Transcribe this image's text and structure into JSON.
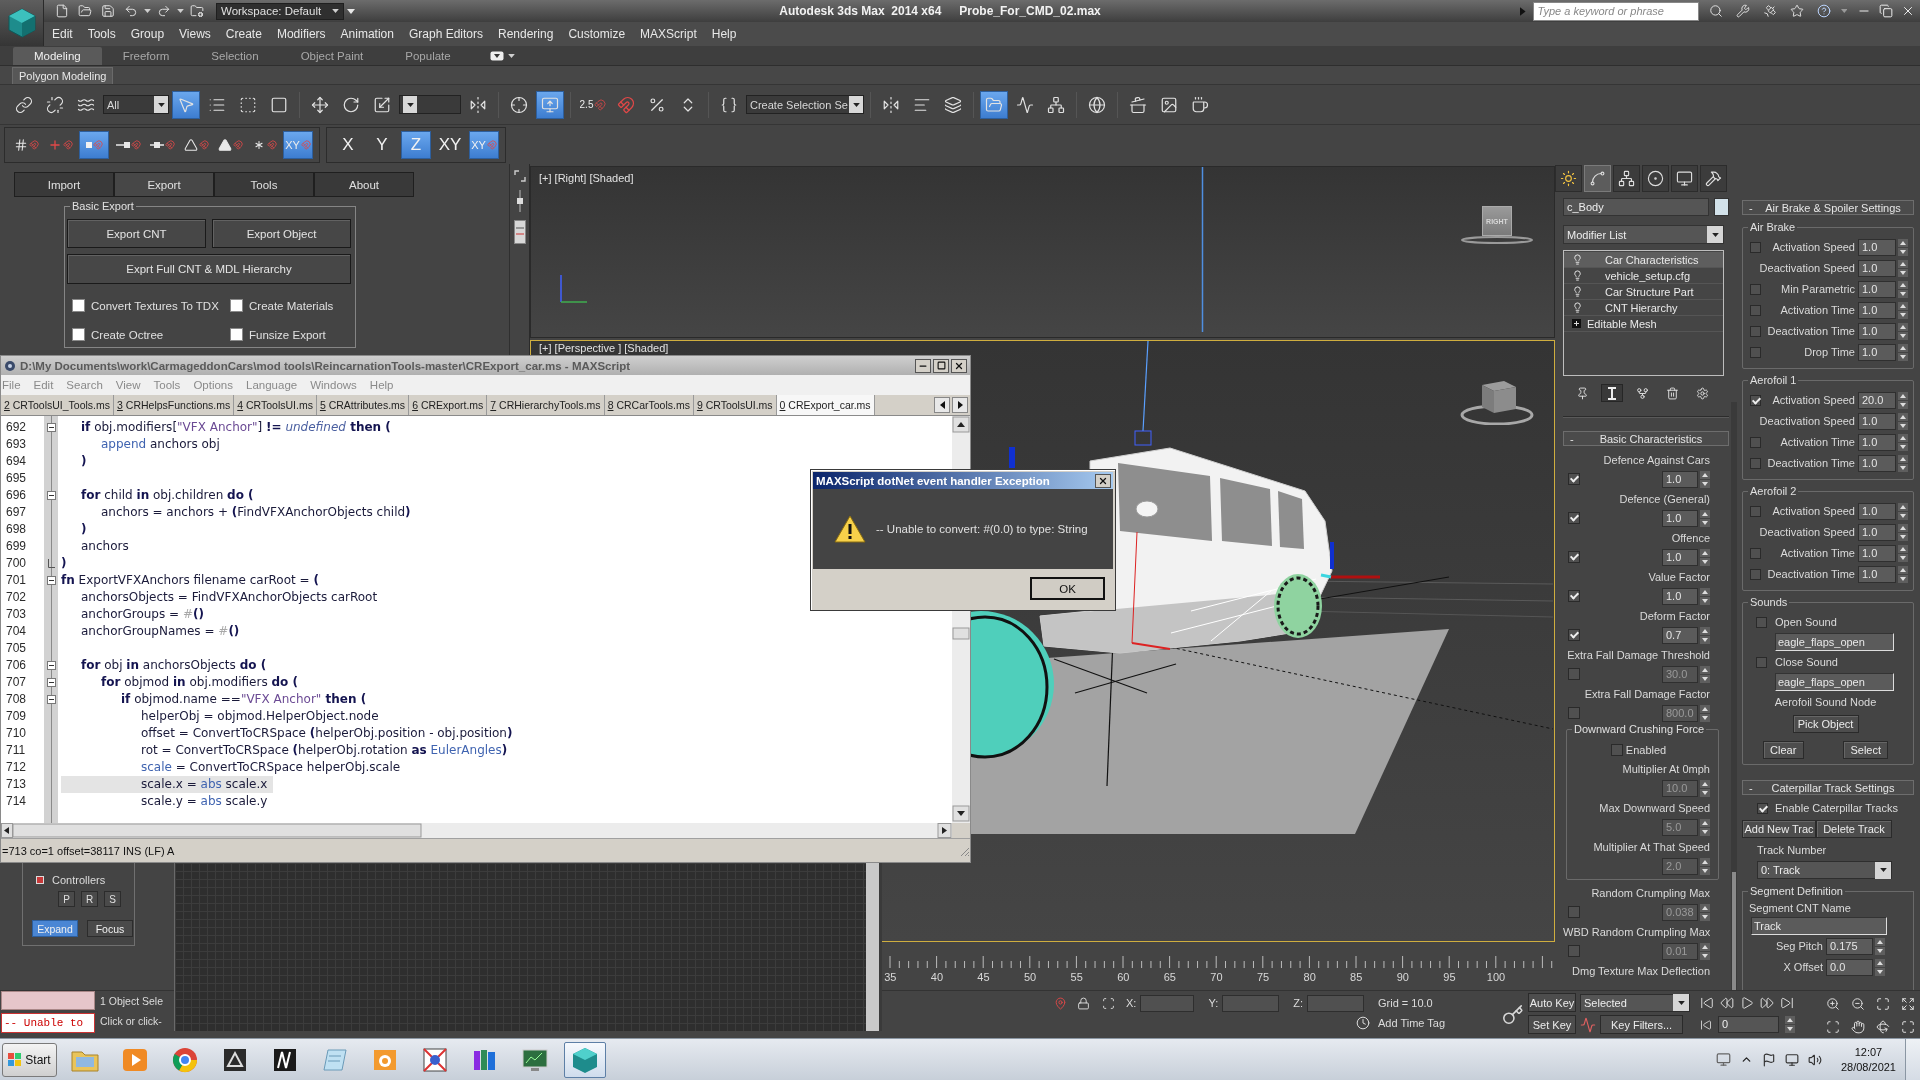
{
  "app": {
    "title": "Autodesk 3ds Max  2014 x64",
    "file": "Probe_For_CMD_02.max",
    "workspace": "Workspace: Default",
    "search_placeholder": "Type a keyword or phrase"
  },
  "menu": [
    "Edit",
    "Tools",
    "Group",
    "Views",
    "Create",
    "Modifiers",
    "Animation",
    "Graph Editors",
    "Rendering",
    "Customize",
    "MAXScript",
    "Help"
  ],
  "ribbon": {
    "tabs": [
      {
        "label": "Modeling",
        "selected": true
      },
      {
        "label": "Freeform",
        "selected": false
      },
      {
        "label": "Selection",
        "selected": false
      },
      {
        "label": "Object Paint",
        "selected": false
      },
      {
        "label": "Populate",
        "selected": false
      }
    ],
    "panel": "Polygon Modeling"
  },
  "main_toolbar": [
    {
      "kind": "link",
      "selected": false
    },
    {
      "kind": "unlink",
      "selected": false
    },
    {
      "kind": "bind",
      "selected": false
    },
    {
      "kind": "filter",
      "value": "All"
    },
    {
      "kind": "select",
      "selected": true
    },
    {
      "kind": "select_by_name",
      "selected": false
    },
    {
      "kind": "region",
      "selected": false
    },
    {
      "kind": "crossing",
      "selected": false
    },
    {
      "kind": "separator"
    },
    {
      "kind": "move",
      "selected": false
    },
    {
      "kind": "rotate",
      "selected": false
    },
    {
      "kind": "scale",
      "selected": false
    },
    {
      "kind": "coordinates"
    },
    {
      "kind": "pivot",
      "selected": false
    },
    {
      "kind": "separator"
    },
    {
      "kind": "manipulate",
      "selected": false
    },
    {
      "kind": "shortcuts",
      "selected": true
    },
    {
      "kind": "separator"
    },
    {
      "kind": "snap",
      "label": "2.5",
      "selected": false
    },
    {
      "kind": "angle_snap",
      "selected": false
    },
    {
      "kind": "percent_snap",
      "selected": false
    },
    {
      "kind": "spinner_snap",
      "selected": false
    },
    {
      "kind": "separator"
    },
    {
      "kind": "named_sets",
      "selected": false
    },
    {
      "kind": "selection_sets",
      "value": "Create Selection Se"
    },
    {
      "kind": "separator"
    },
    {
      "kind": "mirror",
      "selected": false
    },
    {
      "kind": "align",
      "selected": false
    },
    {
      "kind": "layers",
      "selected": false
    },
    {
      "kind": "separator"
    },
    {
      "kind": "explorer",
      "selected": true
    },
    {
      "kind": "curves",
      "selected": false
    },
    {
      "kind": "schematic",
      "selected": false
    },
    {
      "kind": "separator"
    },
    {
      "kind": "material",
      "selected": false
    },
    {
      "kind": "separator"
    },
    {
      "kind": "render_setup",
      "selected": false
    },
    {
      "kind": "frame_window",
      "selected": false
    },
    {
      "kind": "render",
      "selected": false
    }
  ],
  "snap_toolbar": {
    "snaps": [
      {
        "kind": "grid",
        "selected": false
      },
      {
        "kind": "pivot",
        "selected": false
      },
      {
        "kind": "vertex",
        "selected": true
      },
      {
        "kind": "endpoint",
        "selected": false
      },
      {
        "kind": "midpoint",
        "selected": false
      },
      {
        "kind": "edge",
        "selected": false
      },
      {
        "kind": "face",
        "selected": false
      },
      {
        "kind": "center",
        "selected": false
      },
      {
        "kind": "plane",
        "label": "XY",
        "selected": true
      }
    ],
    "axes": [
      {
        "kind": "axis",
        "label": "X",
        "selected": false
      },
      {
        "kind": "axis",
        "label": "Y",
        "selected": false
      },
      {
        "kind": "axis",
        "label": "Z",
        "selected": true
      },
      {
        "kind": "axis",
        "label": "XY",
        "selected": false
      },
      {
        "kind": "axis_snap",
        "label": "XY",
        "selected": true
      }
    ]
  },
  "tool_panel": {
    "tabs": [
      {
        "label": "Import",
        "selected": false
      },
      {
        "label": "Export",
        "selected": true
      },
      {
        "label": "Tools",
        "selected": false
      },
      {
        "label": "About",
        "selected": false
      }
    ],
    "group": "Basic Export",
    "buttons": [
      "Export CNT",
      "Export Object",
      "Exprt Full CNT & MDL Hierarchy"
    ],
    "options": [
      {
        "label": "Convert Textures To TDX",
        "checked": false
      },
      {
        "label": "Create Materials",
        "checked": false
      },
      {
        "label": "Create Octree",
        "checked": false
      },
      {
        "label": "Funsize Export",
        "checked": false
      }
    ]
  },
  "controllers": {
    "title": "Controllers",
    "buttons": [
      "P",
      "R",
      "S"
    ],
    "modes": [
      {
        "label": "Expand",
        "selected": true
      },
      {
        "label": "Focus",
        "selected": false
      }
    ]
  },
  "viewports": [
    {
      "kind": "side",
      "label": "[+] [Right] [Shaded]",
      "active": false,
      "cube_label": "RIGHT"
    },
    {
      "kind": "perspective",
      "label": "[+] [Perspective ] [Shaded]",
      "active": true
    }
  ],
  "timeline": {
    "ticks": [
      "35",
      "40",
      "45",
      "50",
      "55",
      "60",
      "65",
      "70",
      "75",
      "80",
      "85",
      "90",
      "95",
      "100"
    ]
  },
  "script_editor": {
    "title": "D:\\My Documents\\work\\CarmageddonCars\\mod tools\\ReincarnationTools-master\\CRExport_car.ms - MAXScript",
    "menu": [
      "File",
      "Edit",
      "Search",
      "View",
      "Tools",
      "Options",
      "Language",
      "Windows",
      "Help"
    ],
    "tabs": [
      {
        "key": "2",
        "name": "CRToolsUI_Tools.ms",
        "selected": false
      },
      {
        "key": "3",
        "name": "CRHelpsFunctions.ms",
        "selected": false
      },
      {
        "key": "4",
        "name": "CRToolsUI.ms",
        "selected": false
      },
      {
        "key": "5",
        "name": "CRAttributes.ms",
        "selected": false
      },
      {
        "key": "6",
        "name": "CRExport.ms",
        "selected": false
      },
      {
        "key": "7",
        "name": "CRHierarchyTools.ms",
        "selected": false
      },
      {
        "key": "8",
        "name": "CRCarTools.ms",
        "selected": false
      },
      {
        "key": "9",
        "name": "CRToolsUI.ms",
        "selected": false
      },
      {
        "key": "0",
        "name": "CRExport_car.ms",
        "selected": true
      }
    ],
    "lines": [
      {
        "number": "692",
        "kind": "block_start",
        "current": false,
        "tokens": [
          {
            "kind": "keyword",
            "text": "\tif"
          },
          {
            "kind": "plain",
            "text": " obj.modifiers["
          },
          {
            "kind": "string",
            "text": "\"VFX Anchor\""
          },
          {
            "kind": "plain",
            "text": "] "
          },
          {
            "kind": "keyword",
            "text": "!="
          },
          {
            "kind": "constant",
            "text": " undefined"
          },
          {
            "kind": "keyword",
            "text": " then ("
          }
        ]
      },
      {
        "number": "693",
        "kind": "code",
        "current": false,
        "tokens": [
          {
            "kind": "builtin",
            "text": "\t\tappend"
          },
          {
            "kind": "plain",
            "text": " anchors obj"
          }
        ]
      },
      {
        "number": "694",
        "kind": "code",
        "current": false,
        "tokens": [
          {
            "kind": "keyword",
            "text": "\t)"
          }
        ]
      },
      {
        "number": "695",
        "kind": "code",
        "current": false
      },
      {
        "number": "696",
        "kind": "block_start",
        "current": false,
        "tokens": [
          {
            "kind": "keyword",
            "text": "\tfor"
          },
          {
            "kind": "plain",
            "text": " child "
          },
          {
            "kind": "keyword",
            "text": "in"
          },
          {
            "kind": "plain",
            "text": " obj.children "
          },
          {
            "kind": "keyword",
            "text": "do ("
          }
        ]
      },
      {
        "number": "697",
        "kind": "code",
        "current": false,
        "tokens": [
          {
            "kind": "plain",
            "text": "\t\tanchors = anchors + "
          },
          {
            "kind": "keyword",
            "text": "("
          },
          {
            "kind": "plain",
            "text": "FindVFXAnchorObjects child"
          },
          {
            "kind": "keyword",
            "text": ")"
          }
        ]
      },
      {
        "number": "698",
        "kind": "code",
        "current": false,
        "tokens": [
          {
            "kind": "keyword",
            "text": "\t)"
          }
        ]
      },
      {
        "number": "699",
        "kind": "code",
        "current": false,
        "tokens": [
          {
            "kind": "plain",
            "text": "\tanchors"
          }
        ]
      },
      {
        "number": "700",
        "kind": "block_end",
        "current": false,
        "tokens": [
          {
            "kind": "keyword",
            "text": ")"
          }
        ]
      },
      {
        "number": "701",
        "kind": "block_start",
        "current": false,
        "tokens": [
          {
            "kind": "keyword",
            "text": "fn"
          },
          {
            "kind": "plain",
            "text": " ExportVFXAnchors filename carRoot = "
          },
          {
            "kind": "keyword",
            "text": "("
          }
        ]
      },
      {
        "number": "702",
        "kind": "code",
        "current": false,
        "tokens": [
          {
            "kind": "plain",
            "text": "\tanchorsObjects = FindVFXAnchorObjects carRoot"
          }
        ]
      },
      {
        "number": "703",
        "kind": "code",
        "current": false,
        "tokens": [
          {
            "kind": "plain",
            "text": "\tanchorGroups = "
          },
          {
            "kind": "symbol",
            "text": "#"
          },
          {
            "kind": "keyword",
            "text": "()"
          }
        ]
      },
      {
        "number": "704",
        "kind": "code",
        "current": false,
        "tokens": [
          {
            "kind": "plain",
            "text": "\tanchorGroupNames = "
          },
          {
            "kind": "symbol",
            "text": "#"
          },
          {
            "kind": "keyword",
            "text": "()"
          }
        ]
      },
      {
        "number": "705",
        "kind": "code",
        "current": false
      },
      {
        "number": "706",
        "kind": "block_start",
        "current": false,
        "tokens": [
          {
            "kind": "keyword",
            "text": "\tfor"
          },
          {
            "kind": "plain",
            "text": " obj "
          },
          {
            "kind": "keyword",
            "text": "in"
          },
          {
            "kind": "plain",
            "text": " anchorsObjects "
          },
          {
            "kind": "keyword",
            "text": "do ("
          }
        ]
      },
      {
        "number": "707",
        "kind": "block_start",
        "current": false,
        "tokens": [
          {
            "kind": "keyword",
            "text": "\t\tfor"
          },
          {
            "kind": "plain",
            "text": " objmod "
          },
          {
            "kind": "keyword",
            "text": "in"
          },
          {
            "kind": "plain",
            "text": " obj.modifiers "
          },
          {
            "kind": "keyword",
            "text": "do ("
          }
        ]
      },
      {
        "number": "708",
        "kind": "block_start",
        "current": false,
        "tokens": [
          {
            "kind": "keyword",
            "text": "\t\t\tif"
          },
          {
            "kind": "plain",
            "text": " objmod.name =="
          },
          {
            "kind": "string",
            "text": "\"VFX Anchor\""
          },
          {
            "kind": "keyword",
            "text": " then ("
          }
        ]
      },
      {
        "number": "709",
        "kind": "code",
        "current": false,
        "tokens": [
          {
            "kind": "plain",
            "text": "\t\t\t\thelperObj = objmod.HelperObject.node"
          }
        ]
      },
      {
        "number": "710",
        "kind": "code",
        "current": false,
        "tokens": [
          {
            "kind": "plain",
            "text": "\t\t\t\toffset = ConvertToCRSpace "
          },
          {
            "kind": "keyword",
            "text": "("
          },
          {
            "kind": "plain",
            "text": "helperObj.position - obj.position"
          },
          {
            "kind": "keyword",
            "text": ")"
          }
        ]
      },
      {
        "number": "711",
        "kind": "code",
        "current": false,
        "tokens": [
          {
            "kind": "plain",
            "text": "\t\t\t\trot = ConvertToCRSpace "
          },
          {
            "kind": "keyword",
            "text": "("
          },
          {
            "kind": "plain",
            "text": "helperObj.rotation "
          },
          {
            "kind": "keyword",
            "text": "as"
          },
          {
            "kind": "builtin",
            "text": " EulerAngles"
          },
          {
            "kind": "keyword",
            "text": ")"
          }
        ]
      },
      {
        "number": "712",
        "kind": "code",
        "current": false,
        "tokens": [
          {
            "kind": "builtin",
            "text": "\t\t\t\tscale"
          },
          {
            "kind": "plain",
            "text": " = ConvertToCRSpace helperObj.scale"
          }
        ]
      },
      {
        "number": "713",
        "kind": "code",
        "current": true,
        "tokens": [
          {
            "kind": "plain",
            "text": "\t\t\t\tscale.x = "
          },
          {
            "kind": "builtin",
            "text": "abs"
          },
          {
            "kind": "plain",
            "text": " scale.x"
          }
        ]
      },
      {
        "number": "714",
        "kind": "code",
        "current": false,
        "tokens": [
          {
            "kind": "plain",
            "text": "\t\t\t\tscale.y = "
          },
          {
            "kind": "builtin",
            "text": "abs"
          },
          {
            "kind": "plain",
            "text": " scale.y"
          }
        ]
      }
    ],
    "status": "=713 co=1 offset=38117 INS (LF) A"
  },
  "dialog": {
    "title": "MAXScript dotNet event handler Exception",
    "message": "-- Unable to convert: #(0.0) to type: String",
    "button": "OK"
  },
  "command_panel": {
    "tabs": [
      {
        "kind": "create",
        "selected": false
      },
      {
        "kind": "modify",
        "selected": true
      },
      {
        "kind": "hierarchy",
        "selected": false
      },
      {
        "kind": "motion",
        "selected": false
      },
      {
        "kind": "display",
        "selected": false
      },
      {
        "kind": "utilities",
        "selected": false
      }
    ],
    "object": {
      "name": "c_Body",
      "color": "#d3e2ea"
    },
    "modifier_list": "Modifier List",
    "stack": [
      {
        "kind": "modifier",
        "label": "Car Characteristics",
        "selected": true
      },
      {
        "kind": "modifier",
        "label": "vehicle_setup.cfg",
        "selected": false
      },
      {
        "kind": "modifier",
        "label": "Car Structure Part",
        "selected": false
      },
      {
        "kind": "modifier",
        "label": "CNT Hierarchy",
        "selected": false
      },
      {
        "kind": "object",
        "label": "Editable Mesh",
        "selected": false
      }
    ],
    "stack_tools": [
      {
        "kind": "pin",
        "selected": false
      },
      {
        "kind": "end_result",
        "selected": true
      },
      {
        "kind": "unique",
        "selected": false
      },
      {
        "kind": "remove",
        "selected": false
      },
      {
        "kind": "configure",
        "selected": false
      }
    ],
    "basic": {
      "toggle": "-",
      "title": "Basic Characteristics",
      "params": [
        {
          "kind": "check_spinner",
          "label": "Defence Against Cars",
          "checked": true,
          "value": "1.0",
          "disabled": false
        },
        {
          "kind": "check_spinner",
          "label": "Defence (General)",
          "checked": true,
          "value": "1.0",
          "disabled": false
        },
        {
          "kind": "check_spinner",
          "label": "Offence",
          "checked": true,
          "value": "1.0",
          "disabled": false
        },
        {
          "kind": "check_spinner",
          "label": "Value Factor",
          "checked": true,
          "value": "1.0",
          "disabled": false
        },
        {
          "kind": "check_spinner",
          "label": "Deform Factor",
          "checked": true,
          "value": "0.7",
          "disabled": false
        },
        {
          "kind": "check_spinner",
          "label": "Extra Fall Damage Threshold",
          "checked": false,
          "value": "30.0",
          "disabled": true
        },
        {
          "kind": "check_spinner",
          "label": "Extra Fall Damage Factor",
          "checked": false,
          "value": "800.0",
          "disabled": true
        },
        {
          "kind": "group",
          "title": "Downward Crushing Force",
          "items": [
            {
              "kind": "checkbox",
              "label": "Enabled",
              "checked": false
            },
            {
              "kind": "spinner",
              "label": "Multiplier At 0mph",
              "value": "10.0",
              "disabled": true
            },
            {
              "kind": "spinner",
              "label": "Max Downward Speed",
              "value": "5.0",
              "disabled": true
            },
            {
              "kind": "spinner",
              "label": "Multiplier At That Speed",
              "value": "2.0",
              "disabled": true
            }
          ]
        },
        {
          "kind": "check_spinner",
          "label": "Random Crumpling Max",
          "checked": false,
          "value": "0.038",
          "disabled": true
        },
        {
          "kind": "check_spinner",
          "label": "WBD Random Crumpling Max",
          "checked": false,
          "value": "0.01",
          "disabled": true
        },
        {
          "kind": "caption",
          "label": "Dmg Texture Max Deflection"
        }
      ]
    },
    "air_brake": {
      "toggle": "-",
      "title": "Air Brake & Spoiler Settings",
      "groups": [
        {
          "title": "Air Brake",
          "rows": [
            {
              "kind": "check_spinner",
              "label": "Activation Speed",
              "checked": false,
              "value": "1.0"
            },
            {
              "kind": "spinner",
              "label": "Deactivation Speed",
              "value": "1.0"
            },
            {
              "kind": "check_spinner",
              "label": "Min Parametric",
              "checked": false,
              "value": "1.0"
            },
            {
              "kind": "check_spinner",
              "label": "Activation Time",
              "checked": false,
              "value": "1.0"
            },
            {
              "kind": "check_spinner",
              "label": "Deactivation Time",
              "checked": false,
              "value": "1.0"
            },
            {
              "kind": "check_spinner",
              "label": "Drop Time",
              "checked": false,
              "value": "1.0"
            }
          ]
        },
        {
          "title": "Aerofoil 1",
          "rows": [
            {
              "kind": "check_spinner",
              "label": "Activation Speed",
              "checked": true,
              "value": "20.0"
            },
            {
              "kind": "spinner",
              "label": "Deactivation Speed",
              "value": "1.0"
            },
            {
              "kind": "check_spinner",
              "label": "Activation Time",
              "checked": false,
              "value": "1.0"
            },
            {
              "kind": "check_spinner",
              "label": "Deactivation Time",
              "checked": false,
              "value": "1.0"
            }
          ]
        },
        {
          "title": "Aerofoil 2",
          "rows": [
            {
              "kind": "check_spinner",
              "label": "Activation Speed",
              "checked": false,
              "value": "1.0"
            },
            {
              "kind": "spinner",
              "label": "Deactivation Speed",
              "value": "1.0"
            },
            {
              "kind": "check_spinner",
              "label": "Activation Time",
              "checked": false,
              "value": "1.0"
            },
            {
              "kind": "check_spinner",
              "label": "Deactivation Time",
              "checked": false,
              "value": "1.0"
            }
          ]
        }
      ],
      "sounds": {
        "title": "Sounds",
        "items": [
          {
            "kind": "checkbox",
            "label": "Open Sound",
            "checked": false
          },
          {
            "kind": "field",
            "value": "eagle_flaps_open"
          },
          {
            "kind": "checkbox",
            "label": "Close Sound",
            "checked": false
          },
          {
            "kind": "field",
            "value": "eagle_flaps_open"
          },
          {
            "kind": "caption",
            "label": "Aerofoil Sound Node"
          },
          {
            "kind": "button",
            "label": "Pick Object"
          },
          {
            "kind": "buttons",
            "labels": [
              "Clear",
              "Select"
            ]
          }
        ]
      }
    },
    "caterpillar": {
      "toggle": "-",
      "title": "Caterpillar Track Settings",
      "enable": {
        "label": "Enable Caterpillar Tracks",
        "checked": true
      },
      "buttons": [
        "Add New Trac",
        "Delete Track"
      ],
      "track_label": "Track Number",
      "track": "0: Track",
      "segment": {
        "title": "Segment Definition",
        "name_label": "Segment CNT Name",
        "name": "Track",
        "rows": [
          {
            "label": "Seg Pitch",
            "value": "0.175"
          },
          {
            "label": "X Offset",
            "value": "0.0"
          }
        ]
      }
    }
  },
  "status_bar": {
    "listener_output": "-- Unable to",
    "selection": "1 Object Sele",
    "prompt": "Click or click-",
    "coords": [
      "X:",
      "Y:",
      "Z:"
    ],
    "grid": "Grid = 10.0",
    "time_tag": "Add Time Tag",
    "auto_key": "Auto Key",
    "key_mode": "Selected",
    "set_key": "Set Key",
    "key_filters": "Key Filters...",
    "frame": "0"
  },
  "taskbar": {
    "start": "Start",
    "apps": [
      {
        "kind": "folder",
        "selected": false
      },
      {
        "kind": "player",
        "selected": false
      },
      {
        "kind": "browser",
        "selected": false
      },
      {
        "kind": "tile",
        "selected": false
      },
      {
        "kind": "clapper",
        "selected": false
      },
      {
        "kind": "notepad",
        "selected": false
      },
      {
        "kind": "camera",
        "selected": false
      },
      {
        "kind": "shapes",
        "selected": false
      },
      {
        "kind": "books",
        "selected": false
      },
      {
        "kind": "chart",
        "selected": false
      },
      {
        "kind": "max",
        "selected": true
      }
    ],
    "time": "12:07",
    "date": "28/08/2021"
  }
}
